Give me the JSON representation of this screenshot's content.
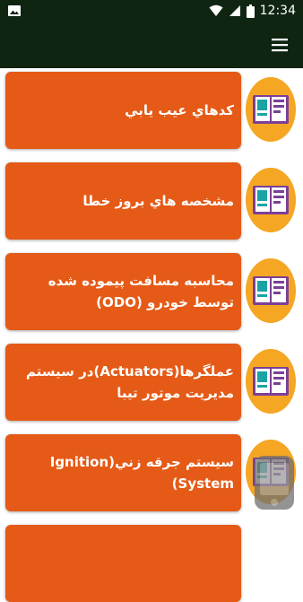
{
  "status_bar": {
    "time": "12:34",
    "icons": [
      "image-icon",
      "wifi-icon",
      "signal-icon",
      "battery-icon"
    ]
  },
  "app_bar": {
    "menu_icon": "hamburger-menu-icon"
  },
  "colors": {
    "app_bar": "#0f2512",
    "card": "#e55a17",
    "icon_circle": "#f5a623"
  },
  "items": [
    {
      "label": "كدهاي عيب يابي"
    },
    {
      "label": "مشخصه هاي بروز خطا"
    },
    {
      "label": "محاسبه مسافت پيموده شده توسط خودرو (ODO)"
    },
    {
      "label": "عملگرها(Actuators)در سيستم مديريت موتور تيبا"
    },
    {
      "label": "سيستم جرقه زني(Ignition System)"
    }
  ]
}
